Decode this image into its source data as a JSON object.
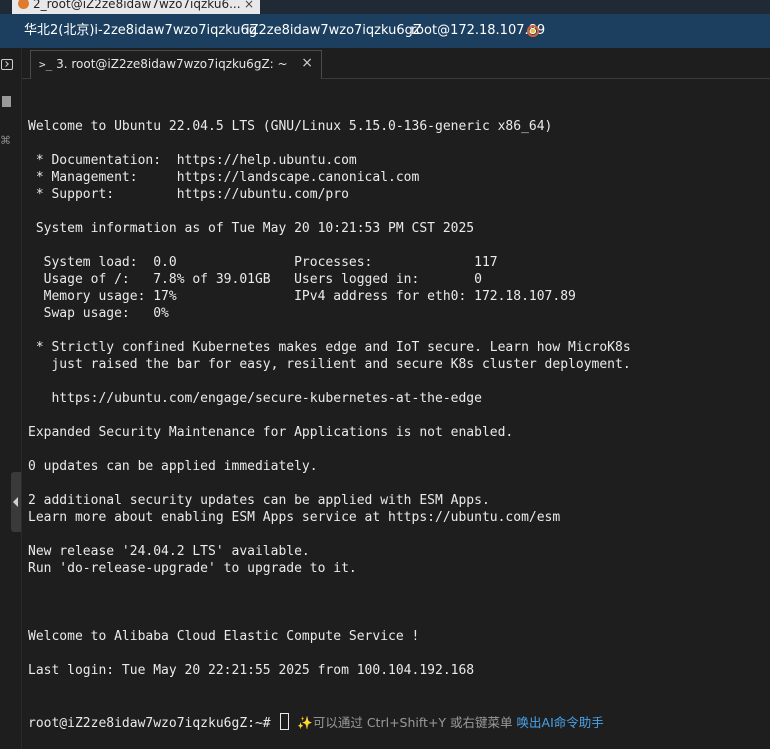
{
  "window_tab": {
    "title": "2_root@iZ2ze8idaw7wzo7iqzku6...",
    "close": "×"
  },
  "session_bar": {
    "region": "华北2(北京)i-2ze8idaw7wzo7iqzku6g",
    "hostname": "iZ2ze8idaw7wzo7iqzku6gZ",
    "user_ip": "root@172.18.107.89"
  },
  "terminal_tab": {
    "prompt_icon": ">_",
    "title": "3. root@iZ2ze8idaw7wzo7iqzku6gZ: ~",
    "close": "×"
  },
  "terminal": {
    "lines": [
      "Welcome to Ubuntu 22.04.5 LTS (GNU/Linux 5.15.0-136-generic x86_64)",
      "",
      " * Documentation:  https://help.ubuntu.com",
      " * Management:     https://landscape.canonical.com",
      " * Support:        https://ubuntu.com/pro",
      "",
      " System information as of Tue May 20 10:21:53 PM CST 2025",
      "",
      "  System load:  0.0               Processes:             117",
      "  Usage of /:   7.8% of 39.01GB   Users logged in:       0",
      "  Memory usage: 17%               IPv4 address for eth0: 172.18.107.89",
      "  Swap usage:   0%",
      "",
      " * Strictly confined Kubernetes makes edge and IoT secure. Learn how MicroK8s",
      "   just raised the bar for easy, resilient and secure K8s cluster deployment.",
      "",
      "   https://ubuntu.com/engage/secure-kubernetes-at-the-edge",
      "",
      "Expanded Security Maintenance for Applications is not enabled.",
      "",
      "0 updates can be applied immediately.",
      "",
      "2 additional security updates can be applied with ESM Apps.",
      "Learn more about enabling ESM Apps service at https://ubuntu.com/esm",
      "",
      "New release '24.04.2 LTS' available.",
      "Run 'do-release-upgrade' to upgrade to it.",
      "",
      "",
      "",
      "Welcome to Alibaba Cloud Elastic Compute Service !",
      "",
      "Last login: Tue May 20 22:21:55 2025 from 100.104.192.168"
    ],
    "prompt": "root@iZ2ze8idaw7wzo7iqzku6gZ:~# ",
    "hint_icon": "✨",
    "hint_text": "可以通过 Ctrl+Shift+Y 或右键菜单 ",
    "hint_link": "唤出AI命令助手"
  },
  "colors": {
    "session_bar": "#1c3f5f",
    "terminal_bg": "#1e1e1e",
    "terminal_fg": "#eaeaea",
    "hint_link": "#4aa3e8"
  }
}
